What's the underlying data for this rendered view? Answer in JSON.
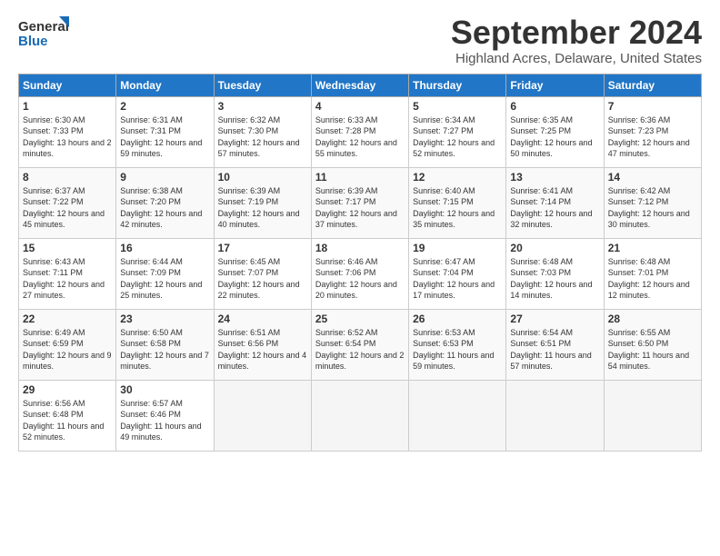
{
  "header": {
    "logo_line1": "General",
    "logo_line2": "Blue",
    "month": "September 2024",
    "location": "Highland Acres, Delaware, United States"
  },
  "weekdays": [
    "Sunday",
    "Monday",
    "Tuesday",
    "Wednesday",
    "Thursday",
    "Friday",
    "Saturday"
  ],
  "weeks": [
    [
      {
        "day": "1",
        "sunrise": "6:30 AM",
        "sunset": "7:33 PM",
        "daylight": "13 hours and 2 minutes."
      },
      {
        "day": "2",
        "sunrise": "6:31 AM",
        "sunset": "7:31 PM",
        "daylight": "12 hours and 59 minutes."
      },
      {
        "day": "3",
        "sunrise": "6:32 AM",
        "sunset": "7:30 PM",
        "daylight": "12 hours and 57 minutes."
      },
      {
        "day": "4",
        "sunrise": "6:33 AM",
        "sunset": "7:28 PM",
        "daylight": "12 hours and 55 minutes."
      },
      {
        "day": "5",
        "sunrise": "6:34 AM",
        "sunset": "7:27 PM",
        "daylight": "12 hours and 52 minutes."
      },
      {
        "day": "6",
        "sunrise": "6:35 AM",
        "sunset": "7:25 PM",
        "daylight": "12 hours and 50 minutes."
      },
      {
        "day": "7",
        "sunrise": "6:36 AM",
        "sunset": "7:23 PM",
        "daylight": "12 hours and 47 minutes."
      }
    ],
    [
      {
        "day": "8",
        "sunrise": "6:37 AM",
        "sunset": "7:22 PM",
        "daylight": "12 hours and 45 minutes."
      },
      {
        "day": "9",
        "sunrise": "6:38 AM",
        "sunset": "7:20 PM",
        "daylight": "12 hours and 42 minutes."
      },
      {
        "day": "10",
        "sunrise": "6:39 AM",
        "sunset": "7:19 PM",
        "daylight": "12 hours and 40 minutes."
      },
      {
        "day": "11",
        "sunrise": "6:39 AM",
        "sunset": "7:17 PM",
        "daylight": "12 hours and 37 minutes."
      },
      {
        "day": "12",
        "sunrise": "6:40 AM",
        "sunset": "7:15 PM",
        "daylight": "12 hours and 35 minutes."
      },
      {
        "day": "13",
        "sunrise": "6:41 AM",
        "sunset": "7:14 PM",
        "daylight": "12 hours and 32 minutes."
      },
      {
        "day": "14",
        "sunrise": "6:42 AM",
        "sunset": "7:12 PM",
        "daylight": "12 hours and 30 minutes."
      }
    ],
    [
      {
        "day": "15",
        "sunrise": "6:43 AM",
        "sunset": "7:11 PM",
        "daylight": "12 hours and 27 minutes."
      },
      {
        "day": "16",
        "sunrise": "6:44 AM",
        "sunset": "7:09 PM",
        "daylight": "12 hours and 25 minutes."
      },
      {
        "day": "17",
        "sunrise": "6:45 AM",
        "sunset": "7:07 PM",
        "daylight": "12 hours and 22 minutes."
      },
      {
        "day": "18",
        "sunrise": "6:46 AM",
        "sunset": "7:06 PM",
        "daylight": "12 hours and 20 minutes."
      },
      {
        "day": "19",
        "sunrise": "6:47 AM",
        "sunset": "7:04 PM",
        "daylight": "12 hours and 17 minutes."
      },
      {
        "day": "20",
        "sunrise": "6:48 AM",
        "sunset": "7:03 PM",
        "daylight": "12 hours and 14 minutes."
      },
      {
        "day": "21",
        "sunrise": "6:48 AM",
        "sunset": "7:01 PM",
        "daylight": "12 hours and 12 minutes."
      }
    ],
    [
      {
        "day": "22",
        "sunrise": "6:49 AM",
        "sunset": "6:59 PM",
        "daylight": "12 hours and 9 minutes."
      },
      {
        "day": "23",
        "sunrise": "6:50 AM",
        "sunset": "6:58 PM",
        "daylight": "12 hours and 7 minutes."
      },
      {
        "day": "24",
        "sunrise": "6:51 AM",
        "sunset": "6:56 PM",
        "daylight": "12 hours and 4 minutes."
      },
      {
        "day": "25",
        "sunrise": "6:52 AM",
        "sunset": "6:54 PM",
        "daylight": "12 hours and 2 minutes."
      },
      {
        "day": "26",
        "sunrise": "6:53 AM",
        "sunset": "6:53 PM",
        "daylight": "11 hours and 59 minutes."
      },
      {
        "day": "27",
        "sunrise": "6:54 AM",
        "sunset": "6:51 PM",
        "daylight": "11 hours and 57 minutes."
      },
      {
        "day": "28",
        "sunrise": "6:55 AM",
        "sunset": "6:50 PM",
        "daylight": "11 hours and 54 minutes."
      }
    ],
    [
      {
        "day": "29",
        "sunrise": "6:56 AM",
        "sunset": "6:48 PM",
        "daylight": "11 hours and 52 minutes."
      },
      {
        "day": "30",
        "sunrise": "6:57 AM",
        "sunset": "6:46 PM",
        "daylight": "11 hours and 49 minutes."
      },
      null,
      null,
      null,
      null,
      null
    ]
  ]
}
